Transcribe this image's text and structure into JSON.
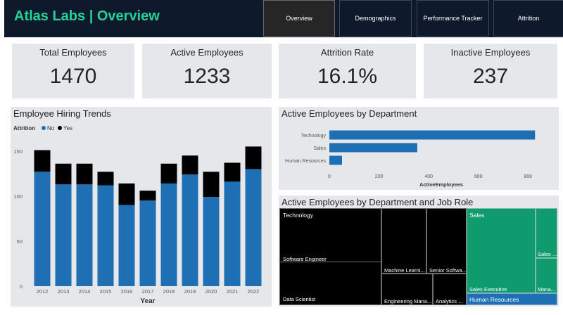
{
  "header": {
    "title": "Atlas Labs | Overview",
    "nav": [
      {
        "label": "Overview",
        "active": true
      },
      {
        "label": "Demographics",
        "active": false
      },
      {
        "label": "Performance Tracker",
        "active": false
      },
      {
        "label": "Attrition",
        "active": false
      }
    ]
  },
  "kpis": [
    {
      "label": "Total Employees",
      "value": "1470"
    },
    {
      "label": "Active Employees",
      "value": "1233"
    },
    {
      "label": "Attrition Rate",
      "value": "16.1%"
    },
    {
      "label": "Inactive Employees",
      "value": "237"
    }
  ],
  "colors": {
    "no": "#1f6fb4",
    "yes": "#000000",
    "accent": "#22d39a",
    "sales": "#0f9b6d"
  },
  "chart_data": [
    {
      "type": "bar",
      "stacked": true,
      "title": "Employee Hiring Trends",
      "legend_title": "Attrition",
      "xlabel": "Year",
      "ylabel": "",
      "categories": [
        "2012",
        "2013",
        "2014",
        "2015",
        "2016",
        "2017",
        "2018",
        "2019",
        "2020",
        "2021",
        "2022"
      ],
      "series": [
        {
          "name": "No",
          "values": [
            127,
            113,
            113,
            112,
            90,
            95,
            114,
            124,
            99,
            116,
            130
          ]
        },
        {
          "name": "Yes",
          "values": [
            24,
            23,
            23,
            15,
            24,
            11,
            22,
            21,
            28,
            21,
            25
          ]
        }
      ],
      "ylim": [
        0,
        160
      ],
      "yticks": [
        0,
        50,
        100,
        150
      ],
      "legend": "top-left"
    },
    {
      "type": "bar",
      "orientation": "horizontal",
      "title": "Active Employees by Department",
      "categories": [
        "Technology",
        "Sales",
        "Human Resources"
      ],
      "values": [
        828,
        354,
        51
      ],
      "xlabel": "ActiveEmployees",
      "xlim": [
        0,
        850
      ],
      "xticks": [
        0,
        200,
        400,
        600,
        800
      ]
    },
    {
      "type": "treemap",
      "title": "Active Employees by Department and Job Role",
      "groups": [
        {
          "name": "Technology",
          "roles": [
            "Software Engineer",
            "Data Scientist",
            "Machine Learni...",
            "Senior Softwa...",
            "Engineering Mana...",
            "Analytics ..."
          ]
        },
        {
          "name": "Sales",
          "roles": [
            "Sales Executive",
            "Sales ...",
            "Mana..."
          ]
        },
        {
          "name": "Human Resources",
          "roles": []
        }
      ]
    }
  ]
}
